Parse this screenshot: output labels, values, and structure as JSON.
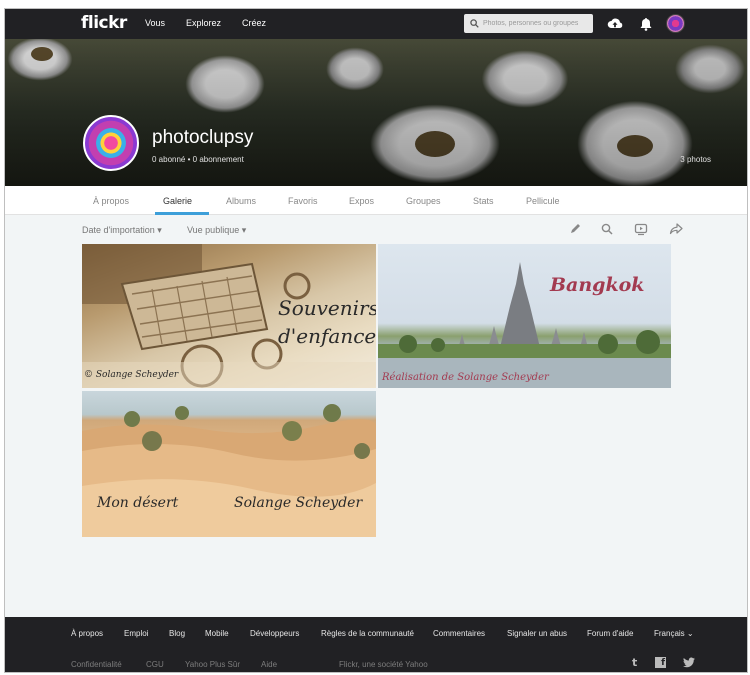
{
  "topnav": {
    "logo": "flickr",
    "links": [
      "Vous",
      "Explorez",
      "Créez"
    ],
    "search_placeholder": "Photos, personnes ou groupes",
    "icons": [
      "upload-cloud-icon",
      "notifications-bell-icon"
    ]
  },
  "profile": {
    "name": "photoclupsy",
    "followers": "0 abonné",
    "separator": "•",
    "following": "0 abonnement",
    "photo_count": "3 photos"
  },
  "tabs": [
    "À propos",
    "Galerie",
    "Albums",
    "Favoris",
    "Expos",
    "Groupes",
    "Stats",
    "Pellicule"
  ],
  "active_tab": "Galerie",
  "accent_color": "#3d9fd9",
  "toolbar": {
    "sort": "Date d'importation ▾",
    "view": "Vue publique ▾",
    "icons": [
      "edit-pencil-icon",
      "search-icon",
      "slideshow-icon",
      "share-icon"
    ]
  },
  "photos": [
    {
      "caption1": "Souvenirs",
      "caption2": "d'enfance",
      "credit": "© Solange Scheyder"
    },
    {
      "title": "Bangkok",
      "credit": "Réalisation de Solange Scheyder"
    },
    {
      "caption1": "Mon désert",
      "caption2": "Solange Scheyder"
    }
  ],
  "footer": {
    "links": [
      "À propos",
      "Emploi",
      "Blog",
      "Mobile",
      "Développeurs",
      "Règles de la communauté",
      "Commentaires",
      "Signaler un abus",
      "Forum d'aide",
      "Français ⌄"
    ],
    "secondary": [
      "Confidentialité",
      "CGU",
      "Yahoo Plus Sûr",
      "Aide"
    ],
    "company": "Flickr, une société Yahoo",
    "social": [
      "t",
      "f",
      "twitter"
    ]
  }
}
